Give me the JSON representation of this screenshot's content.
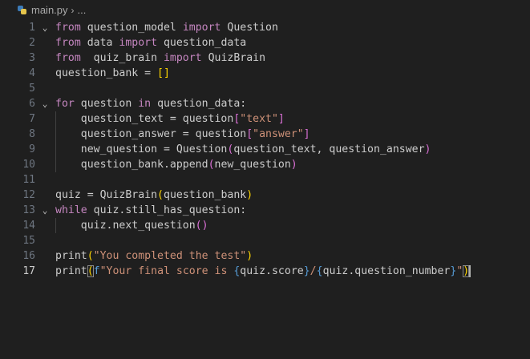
{
  "breadcrumb": {
    "file_name": "main.py",
    "separator": "›",
    "trailing": "..."
  },
  "editor": {
    "active_line": 17,
    "lines": [
      {
        "num": "1",
        "fold": "⌄",
        "tokens": [
          [
            "kw",
            "from"
          ],
          [
            "id",
            " question_model "
          ],
          [
            "kw",
            "import"
          ],
          [
            "id",
            " Question"
          ]
        ]
      },
      {
        "num": "2",
        "fold": "",
        "tokens": [
          [
            "kw",
            "from"
          ],
          [
            "id",
            " data "
          ],
          [
            "kw",
            "import"
          ],
          [
            "id",
            " question_data"
          ]
        ]
      },
      {
        "num": "3",
        "fold": "",
        "tokens": [
          [
            "kw",
            "from"
          ],
          [
            "id",
            "  quiz_brain "
          ],
          [
            "kw",
            "import"
          ],
          [
            "id",
            " QuizBrain"
          ]
        ]
      },
      {
        "num": "4",
        "fold": "",
        "tokens": [
          [
            "id",
            "question_bank = "
          ],
          [
            "p1",
            "[]"
          ]
        ]
      },
      {
        "num": "5",
        "fold": "",
        "tokens": []
      },
      {
        "num": "6",
        "fold": "⌄",
        "tokens": [
          [
            "kw",
            "for"
          ],
          [
            "id",
            " question "
          ],
          [
            "kw",
            "in"
          ],
          [
            "id",
            " question_data:"
          ]
        ]
      },
      {
        "num": "7",
        "fold": "",
        "tokens": [
          [
            "id",
            "    question_text = question"
          ],
          [
            "p2",
            "["
          ],
          [
            "str",
            "\"text\""
          ],
          [
            "p2",
            "]"
          ]
        ]
      },
      {
        "num": "8",
        "fold": "",
        "tokens": [
          [
            "id",
            "    question_answer = question"
          ],
          [
            "p2",
            "["
          ],
          [
            "str",
            "\"answer\""
          ],
          [
            "p2",
            "]"
          ]
        ]
      },
      {
        "num": "9",
        "fold": "",
        "tokens": [
          [
            "id",
            "    new_question = Question"
          ],
          [
            "p2",
            "("
          ],
          [
            "id",
            "question_text, question_answer"
          ],
          [
            "p2",
            ")"
          ]
        ]
      },
      {
        "num": "10",
        "fold": "",
        "tokens": [
          [
            "id",
            "    question_bank.append"
          ],
          [
            "p2",
            "("
          ],
          [
            "id",
            "new_question"
          ],
          [
            "p2",
            ")"
          ]
        ]
      },
      {
        "num": "11",
        "fold": "",
        "tokens": []
      },
      {
        "num": "12",
        "fold": "",
        "tokens": [
          [
            "id",
            "quiz = QuizBrain"
          ],
          [
            "p1",
            "("
          ],
          [
            "id",
            "question_bank"
          ],
          [
            "p1",
            ")"
          ]
        ]
      },
      {
        "num": "13",
        "fold": "⌄",
        "tokens": [
          [
            "kw",
            "while"
          ],
          [
            "id",
            " quiz.still_has_question:"
          ]
        ]
      },
      {
        "num": "14",
        "fold": "",
        "tokens": [
          [
            "id",
            "    quiz.next_question"
          ],
          [
            "p2",
            "()"
          ]
        ]
      },
      {
        "num": "15",
        "fold": "",
        "tokens": []
      },
      {
        "num": "16",
        "fold": "",
        "tokens": [
          [
            "id",
            "print"
          ],
          [
            "p1",
            "("
          ],
          [
            "str",
            "\"You completed the test\""
          ],
          [
            "p1",
            ")"
          ]
        ]
      },
      {
        "num": "17",
        "fold": "",
        "tokens": [
          [
            "id",
            "print"
          ],
          [
            "p1box",
            "("
          ],
          [
            "fstr",
            "f"
          ],
          [
            "str",
            "\"Your final score is "
          ],
          [
            "blue",
            "{"
          ],
          [
            "id",
            "quiz.score"
          ],
          [
            "blue",
            "}"
          ],
          [
            "str",
            "/"
          ],
          [
            "blue",
            "{"
          ],
          [
            "id",
            "quiz.question_number"
          ],
          [
            "blue",
            "}"
          ],
          [
            "str",
            "\""
          ],
          [
            "p1box",
            ")"
          ]
        ]
      }
    ]
  }
}
